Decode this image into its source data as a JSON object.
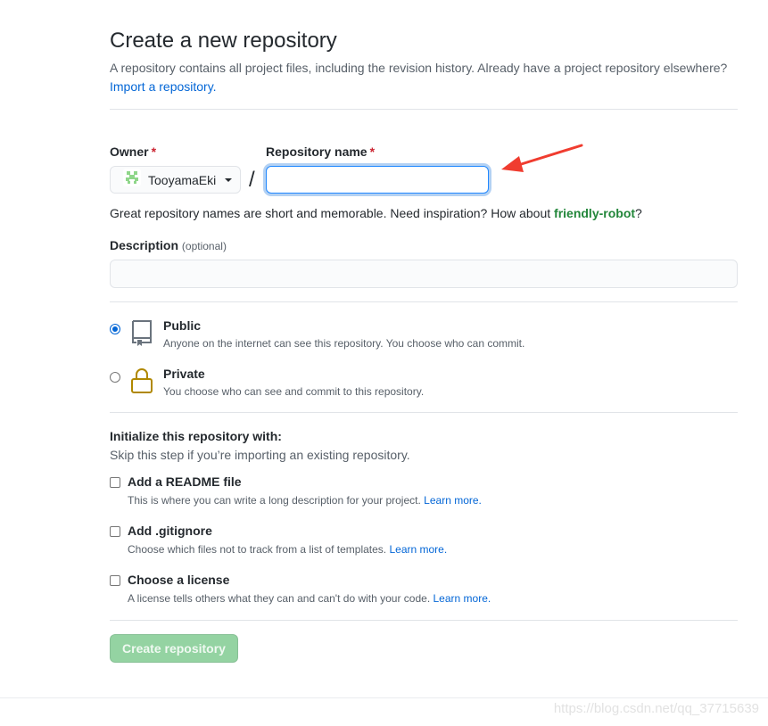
{
  "header": {
    "title": "Create a new repository",
    "description": "A repository contains all project files, including the revision history. Already have a project repository elsewhere?",
    "import_link": "Import a repository."
  },
  "owner": {
    "label": "Owner",
    "required_mark": "*",
    "selected": "TooyamaEki"
  },
  "separator": "/",
  "repo_name": {
    "label": "Repository name",
    "required_mark": "*",
    "value": ""
  },
  "name_hint": {
    "text_before": "Great repository names are short and memorable. Need inspiration? How about ",
    "suggestion": "friendly-robot",
    "text_after": "?"
  },
  "description": {
    "label": "Description",
    "optional": "(optional)",
    "value": ""
  },
  "visibility": [
    {
      "title": "Public",
      "note": "Anyone on the internet can see this repository. You choose who can commit.",
      "selected": true
    },
    {
      "title": "Private",
      "note": "You choose who can see and commit to this repository.",
      "selected": false
    }
  ],
  "init": {
    "heading": "Initialize this repository with:",
    "subheading": "Skip this step if you’re importing an existing repository.",
    "options": [
      {
        "title": "Add a README file",
        "note": "This is where you can write a long description for your project.",
        "link": "Learn more.",
        "checked": false
      },
      {
        "title": "Add .gitignore",
        "note": "Choose which files not to track from a list of templates.",
        "link": "Learn more.",
        "checked": false
      },
      {
        "title": "Choose a license",
        "note": "A license tells others what they can and can't do with your code.",
        "link": "Learn more.",
        "checked": false
      }
    ]
  },
  "submit": {
    "label": "Create repository"
  },
  "watermark": "https://blog.csdn.net/qq_37715639",
  "colors": {
    "accent": "#0366d6",
    "success": "#22863a",
    "button_disabled": "#94d3a2",
    "annotation_arrow": "#f03c2f"
  }
}
